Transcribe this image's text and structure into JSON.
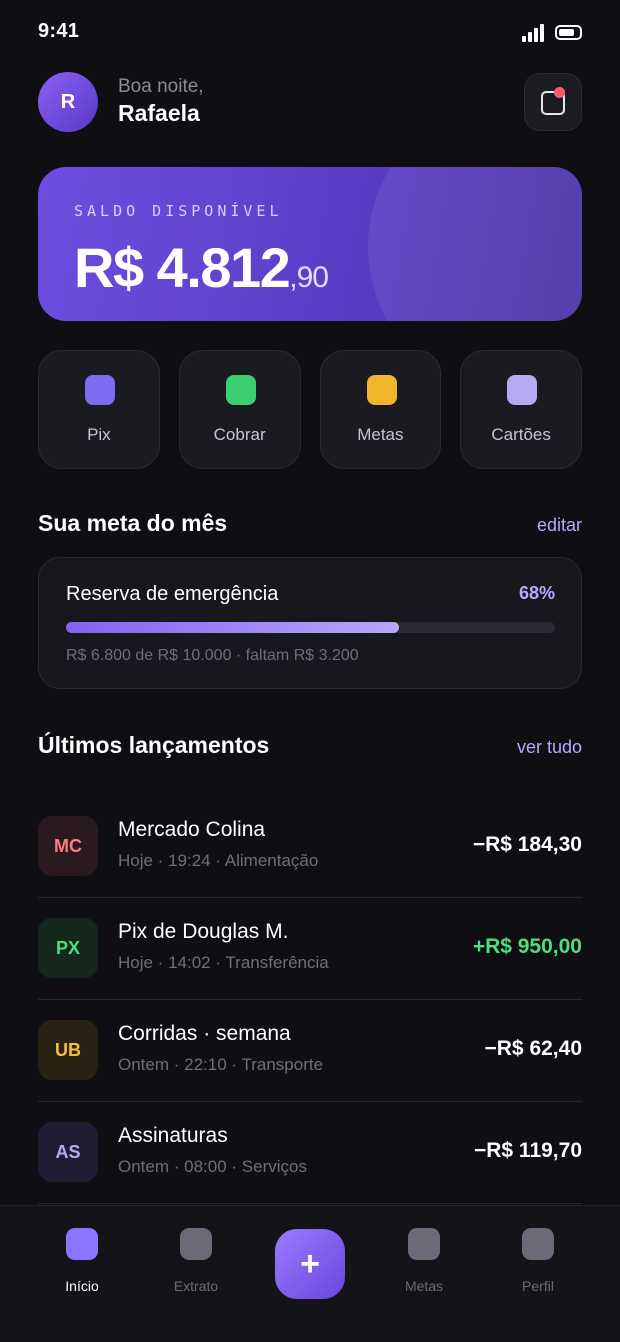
{
  "status_bar": {
    "time": "9:41"
  },
  "header": {
    "avatar_initial": "R",
    "greeting": "Boa noite,",
    "user_name": "Rafaela"
  },
  "balance": {
    "label": "SALDO DISPONÍVEL",
    "amount": "R$ 4.812",
    "cents": ",90"
  },
  "quick_actions": [
    {
      "label": "Pix",
      "color": "#7e6cf0"
    },
    {
      "label": "Cobrar",
      "color": "#3ccf72"
    },
    {
      "label": "Metas",
      "color": "#f0b52a"
    },
    {
      "label": "Cartões",
      "color": "#b7aaf2"
    }
  ],
  "goal_section": {
    "title": "Sua meta do mês",
    "link": "editar",
    "name": "Reserva de emergência",
    "percent_text": "68%",
    "progress": 0.68,
    "detail": "R$ 6.800 de R$ 10.000 · faltam R$ 3.200"
  },
  "transactions_section": {
    "title": "Últimos lançamentos",
    "link": "ver tudo",
    "items": [
      {
        "initials": "MC",
        "name": "Mercado Colina",
        "meta": "Hoje · 19:24 · Alimentação",
        "amount": "−R$ 184,30",
        "icon_bg": "#2a1a1f",
        "icon_fg": "#ff7a86",
        "amount_color": "#ffffff"
      },
      {
        "initials": "PX",
        "name": "Pix de Douglas M.",
        "meta": "Hoje · 14:02 · Transferência",
        "amount": "+R$ 950,00",
        "icon_bg": "#16271d",
        "icon_fg": "#4ade80",
        "amount_color": "#4ade80"
      },
      {
        "initials": "UB",
        "name": "Corridas · semana",
        "meta": "Ontem · 22:10 · Transporte",
        "amount": "−R$ 62,40",
        "icon_bg": "#2a2214",
        "icon_fg": "#f5bf3a",
        "amount_color": "#ffffff"
      },
      {
        "initials": "AS",
        "name": "Assinaturas",
        "meta": "Ontem · 08:00 · Serviços",
        "amount": "−R$ 119,70",
        "icon_bg": "#1f1d33",
        "icon_fg": "#b7aaf5",
        "amount_color": "#ffffff"
      }
    ]
  },
  "tabbar": {
    "fab_symbol": "+",
    "tabs": [
      {
        "label": "Início",
        "active": true
      },
      {
        "label": "Extrato",
        "active": false
      },
      {
        "label": "Metas",
        "active": false
      },
      {
        "label": "Perfil",
        "active": false
      }
    ]
  }
}
